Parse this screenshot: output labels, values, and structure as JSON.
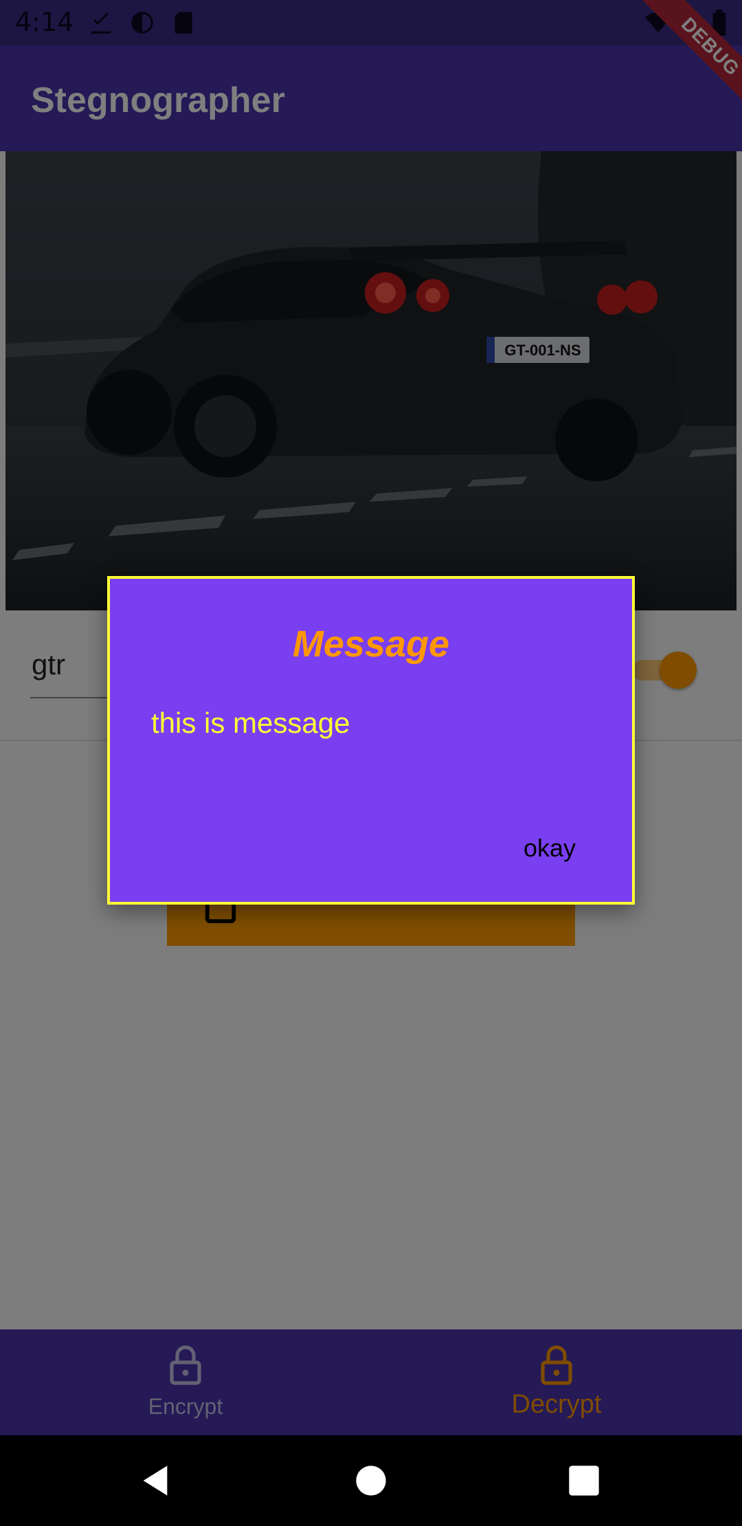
{
  "status_bar": {
    "time": "4:14",
    "icons": [
      "download-icon",
      "app-icon",
      "sd-card-icon",
      "wifi-icon",
      "battery-icon"
    ]
  },
  "app_bar": {
    "title": "Stegnographer"
  },
  "debug_banner": {
    "label": "DEBUG"
  },
  "content": {
    "image_alt": "black sports car on a road",
    "key_input": {
      "value": "gtr"
    },
    "toggle": {
      "on": true
    }
  },
  "dialog": {
    "title": "Message",
    "message": "this is message",
    "ok_label": "okay"
  },
  "bottom_nav": {
    "items": [
      {
        "label": "Encrypt",
        "icon": "lock-icon",
        "selected": false
      },
      {
        "label": "Decrypt",
        "icon": "lock-open-icon",
        "selected": true
      }
    ]
  },
  "system_nav": {
    "buttons": [
      "back-icon",
      "home-icon",
      "recents-icon"
    ]
  },
  "colors": {
    "primary": "#4b32ad",
    "accent": "#ff9800",
    "dialog_bg": "#7a3ff0",
    "dialog_border": "#ffff33"
  }
}
